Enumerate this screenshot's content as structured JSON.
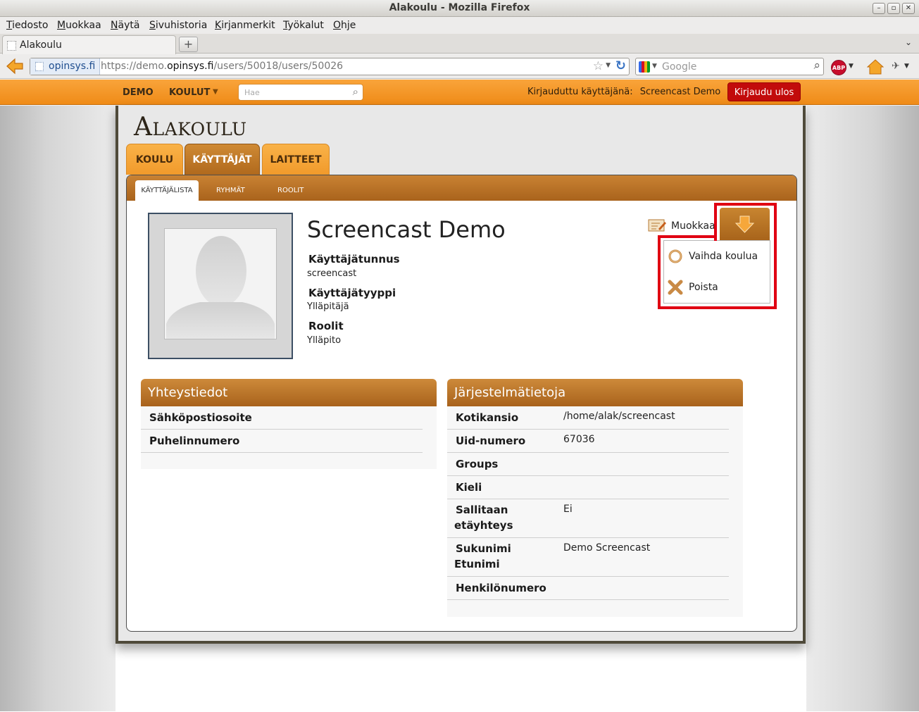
{
  "window": {
    "title": "Alakoulu - Mozilla Firefox",
    "controls": [
      "minimize",
      "maximize",
      "close"
    ]
  },
  "menubar": [
    "Tiedosto",
    "Muokkaa",
    "Näytä",
    "Sivuhistoria",
    "Kirjanmerkit",
    "Työkalut",
    "Ohje"
  ],
  "browser_tab": {
    "title": "Alakoulu"
  },
  "navbar": {
    "identity": "opinsys.fi",
    "url_prefix": "https://demo.",
    "url_domain": "opinsys.fi",
    "url_path": "/users/50018/users/50026",
    "search_engine": "Google",
    "abp_label": "ABP"
  },
  "site_header": {
    "demo": "DEMO",
    "koulut": "KOULUT",
    "search_placeholder": "Hae",
    "logged_in_label": "Kirjauduttu käyttäjänä:",
    "logged_in_user": "Screencast Demo",
    "logout": "Kirjaudu ulos"
  },
  "school": {
    "title": "Alakoulu"
  },
  "main_tabs": [
    {
      "label": "KOULU",
      "active": false
    },
    {
      "label": "KÄYTTÄJÄT",
      "active": true
    },
    {
      "label": "LAITTEET",
      "active": false
    }
  ],
  "sub_tabs": [
    {
      "label": "KÄYTTÄJÄLISTA",
      "active": true
    },
    {
      "label": "RYHMÄT",
      "active": false
    },
    {
      "label": "ROOLIT",
      "active": false
    }
  ],
  "user": {
    "name": "Screencast Demo",
    "fields": [
      {
        "label": "Käyttäjätunnus",
        "value": "screencast"
      },
      {
        "label": "Käyttäjätyyppi",
        "value": "Ylläpitäjä"
      },
      {
        "label": "Roolit",
        "value": "Ylläpito"
      }
    ]
  },
  "actions": {
    "edit": "Muokkaa",
    "menu": [
      {
        "label": "Vaihda koulua",
        "icon": "refresh-icon"
      },
      {
        "label": "Poista",
        "icon": "delete-x-icon"
      }
    ],
    "highlight_color": "#e00012"
  },
  "contact_panel": {
    "title": "Yhteystiedot",
    "rows": [
      {
        "key": "Sähköpostiosoite",
        "value": ""
      },
      {
        "key": "Puhelinnumero",
        "value": ""
      }
    ]
  },
  "system_panel": {
    "title": "Järjestelmätietoja",
    "rows": [
      {
        "key": "Kotikansio",
        "key2": "",
        "value": "/home/alak/screencast"
      },
      {
        "key": "Uid-numero",
        "key2": "",
        "value": "67036"
      },
      {
        "key": "Groups",
        "key2": "",
        "value": ""
      },
      {
        "key": "Kieli",
        "key2": "",
        "value": ""
      },
      {
        "key": "Sallitaan",
        "key2": "etäyhteys",
        "value": "Ei"
      },
      {
        "key": "Sukunimi",
        "key2": "Etunimi",
        "value": "Demo Screencast"
      },
      {
        "key": "Henkilönumero",
        "key2": "",
        "value": ""
      }
    ]
  },
  "colors": {
    "orange_header": "#f19a2b",
    "brown_tab": "#b0691d",
    "logout_red": "#c20b0b"
  }
}
